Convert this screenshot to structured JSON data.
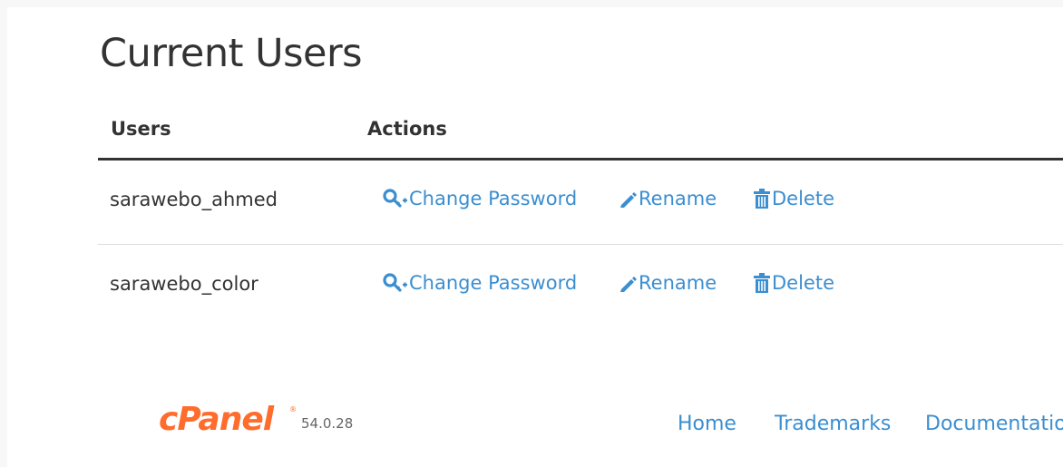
{
  "page": {
    "title": "Current Users"
  },
  "table": {
    "headers": {
      "users": "Users",
      "actions": "Actions"
    },
    "rows": [
      {
        "username": "sarawebo_ahmed",
        "actions": {
          "change_password": "Change Password",
          "rename": "Rename",
          "delete": "Delete"
        }
      },
      {
        "username": "sarawebo_color",
        "actions": {
          "change_password": "Change Password",
          "rename": "Rename",
          "delete": "Delete"
        }
      }
    ]
  },
  "footer": {
    "logo_text": "cPanel",
    "version": "54.0.28",
    "links": {
      "home": "Home",
      "trademarks": "Trademarks",
      "documentation": "Documentation"
    }
  },
  "colors": {
    "link": "#3b8ed0",
    "text": "#333333",
    "brand": "#ff6c2c"
  },
  "icons": {
    "change_password": "key-icon",
    "rename": "pencil-icon",
    "delete": "trash-icon"
  }
}
